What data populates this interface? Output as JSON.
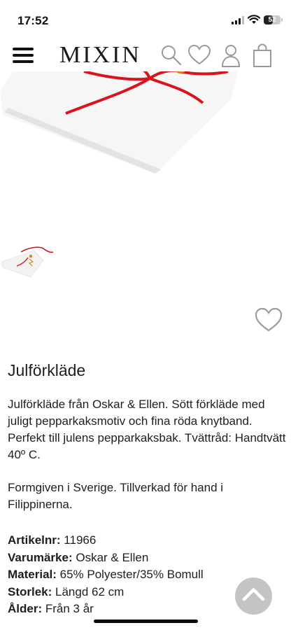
{
  "status_bar": {
    "time": "17:52",
    "battery_level": "52"
  },
  "header": {
    "logo": "MIXIN",
    "icons": [
      "menu-icon",
      "search-icon",
      "heart-icon",
      "user-icon",
      "bag-icon"
    ]
  },
  "product": {
    "title": "Julförkläde",
    "description": "Julförkläde från Oskar & Ellen. Sött förkläde med juligt pepparkaksmotiv och fina röda knytband. Perfekt till julens pepparkaksbak. Tvättråd: Handtvätt 40º C.",
    "origin": "Formgiven i Sverige. Tillverkad för hand i Filippinerna.",
    "specs": {
      "article_label": "Artikelnr:",
      "article_value": " 11966",
      "brand_label": "Varumärke:",
      "brand_value": " Oskar & Ellen",
      "material_label": "Material:",
      "material_value": " 65% Polyester/35% Bomull",
      "size_label": "Storlek:",
      "size_value": " Längd 62 cm",
      "age_label": "Ålder:",
      "age_value": " Från 3 år"
    }
  },
  "colors": {
    "ribbon": "#d8141c",
    "button": "#c4c4c4"
  }
}
